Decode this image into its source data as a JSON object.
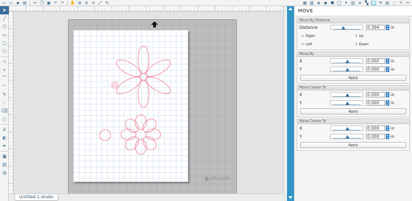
{
  "top_toolbar": {
    "left_icons": [
      "new-doc-icon",
      "open-icon",
      "save-icon",
      "print-icon",
      "cut-icon",
      "copy-icon",
      "paste-icon",
      "undo-icon",
      "redo-icon",
      "pan-icon",
      "zoom-in-icon",
      "zoom-out-icon",
      "zoom-select-icon",
      "fit-icon",
      "redraw-icon"
    ],
    "right_icons": [
      "panel-icon-1",
      "panel-icon-2",
      "panel-icon-3",
      "panel-icon-4",
      "panel-icon-5",
      "panel-icon-6",
      "panel-icon-7",
      "panel-icon-8",
      "panel-icon-9",
      "panel-icon-10",
      "move-panel-icon",
      "panel-icon-12",
      "panel-icon-13",
      "panel-icon-14",
      "panel-icon-15",
      "panel-icon-16"
    ]
  },
  "left_toolbar": {
    "icons": [
      "select-icon",
      "line-icon",
      "polygon-icon",
      "rectangle-icon",
      "rounded-rect-icon",
      "ellipse-icon",
      "freehand-icon",
      "point-edit-icon",
      "curve-icon",
      "arc-icon",
      "pen-icon",
      "knife-icon",
      "eraser-icon",
      "circle-icon",
      "text-icon",
      "fill-icon",
      "pattern-icon",
      "library-icon",
      "store-icon",
      "shape-library-icon"
    ]
  },
  "document": {
    "tab_label": "Untitled-1.studio",
    "mat_logo": "silhouette"
  },
  "move_panel": {
    "title": "MOVE",
    "move_by_distance": {
      "section_title": "Move By Distance",
      "distance_label": "Distance",
      "distance_value": "0.394",
      "unit": "in",
      "slider_fraction": 0.35,
      "right_label": "Right",
      "left_label": "Left",
      "up_label": "Up",
      "down_label": "Down"
    },
    "move_by": {
      "section_title": "Move By",
      "x_label": "X",
      "x_value": "0.000",
      "y_label": "Y",
      "y_value": "0.000",
      "unit": "in",
      "apply_label": "Apply"
    },
    "move_center_to_1": {
      "section_title": "Move Center To",
      "x_label": "X",
      "x_value": "0.000",
      "y_label": "Y",
      "y_value": "0.000",
      "unit": "in",
      "apply_label": "Apply"
    },
    "move_center_to_2": {
      "section_title": "Move Center To",
      "x_label": "X",
      "x_value": "0.000",
      "y_label": "Y",
      "y_value": "0.000",
      "unit": "in",
      "apply_label": "Apply"
    }
  },
  "colors": {
    "accent": "#2f95c5",
    "cut_line": "#f07b8e",
    "grid": "#c8d6ee"
  }
}
